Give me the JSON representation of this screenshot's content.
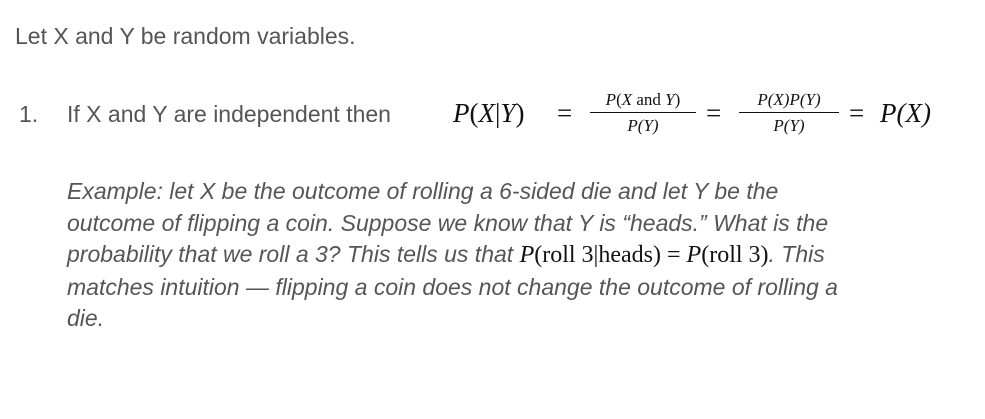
{
  "intro": "Let X and Y be random variables.",
  "list_item": {
    "number": "1.",
    "text": "If X and Y are independent then",
    "formula": {
      "lhs_p": "P",
      "lhs_paren_open": "(",
      "lhs_X": "X",
      "lhs_bar": "|",
      "lhs_Y": "Y",
      "lhs_paren_close": ")",
      "equals": "=",
      "frac1_num_p": "P",
      "frac1_num_open": "(",
      "frac1_num_X": "X",
      "frac1_num_and": " and ",
      "frac1_num_Y": "Y",
      "frac1_num_close": ")",
      "frac1_den": "P(Y)",
      "frac2_num": "P(X)P(Y)",
      "frac2_den": "P(Y)",
      "rhs": "P(X)"
    }
  },
  "example": {
    "lines": [
      "Example: let X be the outcome of rolling a 6-sided die and let Y be the",
      "outcome of flipping a coin. Suppose we know that Y is “heads.” What is the"
    ],
    "line3_before": "probability that we roll a 3? This tells us that ",
    "line3_math_lhs_p": "P",
    "line3_math_lhs_arg": "(roll 3|heads)",
    "line3_math_eq": " = ",
    "line3_math_rhs_p": "P",
    "line3_math_rhs_arg": "(roll 3)",
    "line3_after": ". This",
    "line4": "matches intuition — flipping a coin does not change the outcome of rolling a",
    "line5": "die."
  }
}
